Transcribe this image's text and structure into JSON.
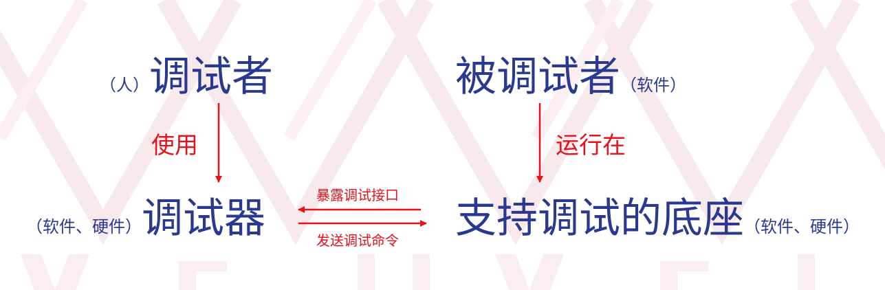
{
  "colors": {
    "node_text": "#2a3990",
    "edge_label": "#e8111b",
    "arrow": "#e8111b",
    "watermark": "#f7e6ea"
  },
  "nodes": {
    "debugger_person": {
      "note": "（人）",
      "title": "调试者"
    },
    "debuggee": {
      "title": "被调试者",
      "note": "（软件）"
    },
    "debugger_tool": {
      "note": "（软件、硬件）",
      "title": "调试器"
    },
    "debug_base": {
      "title": "支持调试的底座",
      "note": "（软件、硬件）"
    }
  },
  "edges": {
    "use": "使用",
    "runs_on": "运行在",
    "expose_interface": "暴露调试接口",
    "send_commands": "发送调试命令"
  }
}
